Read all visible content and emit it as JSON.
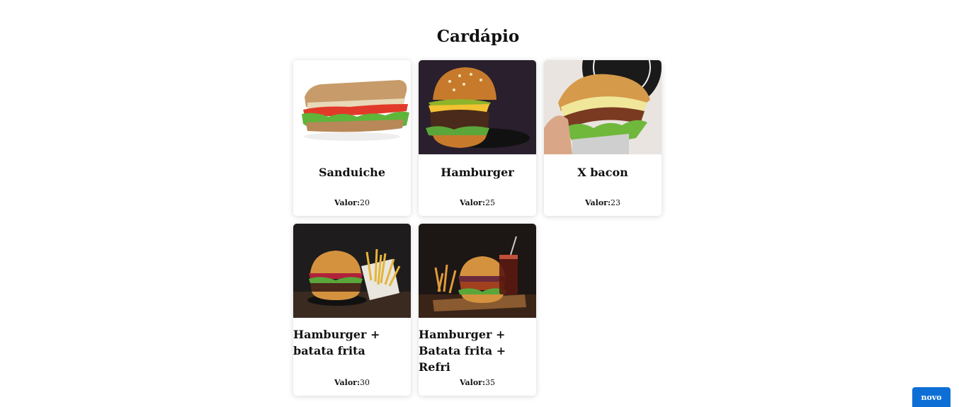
{
  "page": {
    "title": "Cardápio"
  },
  "menu": {
    "price_label": "Valor:",
    "items": [
      {
        "name": "Sanduiche",
        "price": "20",
        "image_icon": "sandwich-image"
      },
      {
        "name": "Hamburger",
        "price": "25",
        "image_icon": "hamburger-image"
      },
      {
        "name": "X bacon",
        "price": "23",
        "image_icon": "x-bacon-image"
      },
      {
        "name": "Hamburger + batata frita",
        "price": "30",
        "image_icon": "hamburger-fries-image"
      },
      {
        "name": "Hamburger + Batata frita + Refri",
        "price": "35",
        "image_icon": "hamburger-fries-soda-image"
      }
    ]
  },
  "actions": {
    "new_label": "novo"
  },
  "colors": {
    "accent": "#0d6fd6"
  }
}
